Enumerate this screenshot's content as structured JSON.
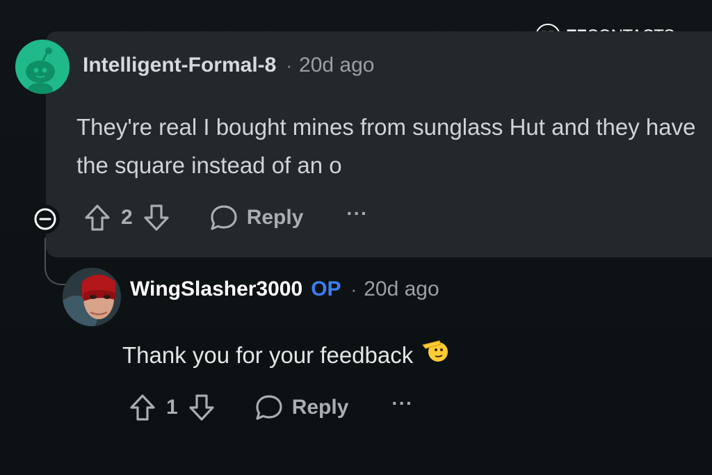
{
  "watermark": {
    "brand_bold": "EZ",
    "brand_light": "CONTACTS"
  },
  "comments": [
    {
      "username": "Intelligent-Formal-8",
      "separator": "·",
      "time": "20d ago",
      "body": "They're real I bought mines from sunglass Hut and they have the square instead of an o",
      "votes": "2",
      "reply_label": "Reply",
      "more_label": "···",
      "avatar_icon": "reddit-snoo-avatar",
      "highlight_color": "#22282b"
    },
    {
      "username": "WingSlasher3000",
      "badge": "OP",
      "separator": "·",
      "time": "20d ago",
      "body": "Thank you for your feedback",
      "emoji": "🫡",
      "votes": "1",
      "reply_label": "Reply",
      "more_label": "···",
      "avatar_icon": "masked-hero-avatar",
      "badge_color": "#3b7ff0"
    }
  ],
  "icons": {
    "upvote": "arrow-up-icon",
    "downvote": "arrow-down-icon",
    "reply": "speech-bubble-icon",
    "collapse": "collapse-minus-icon",
    "more": "ellipsis-icon"
  }
}
